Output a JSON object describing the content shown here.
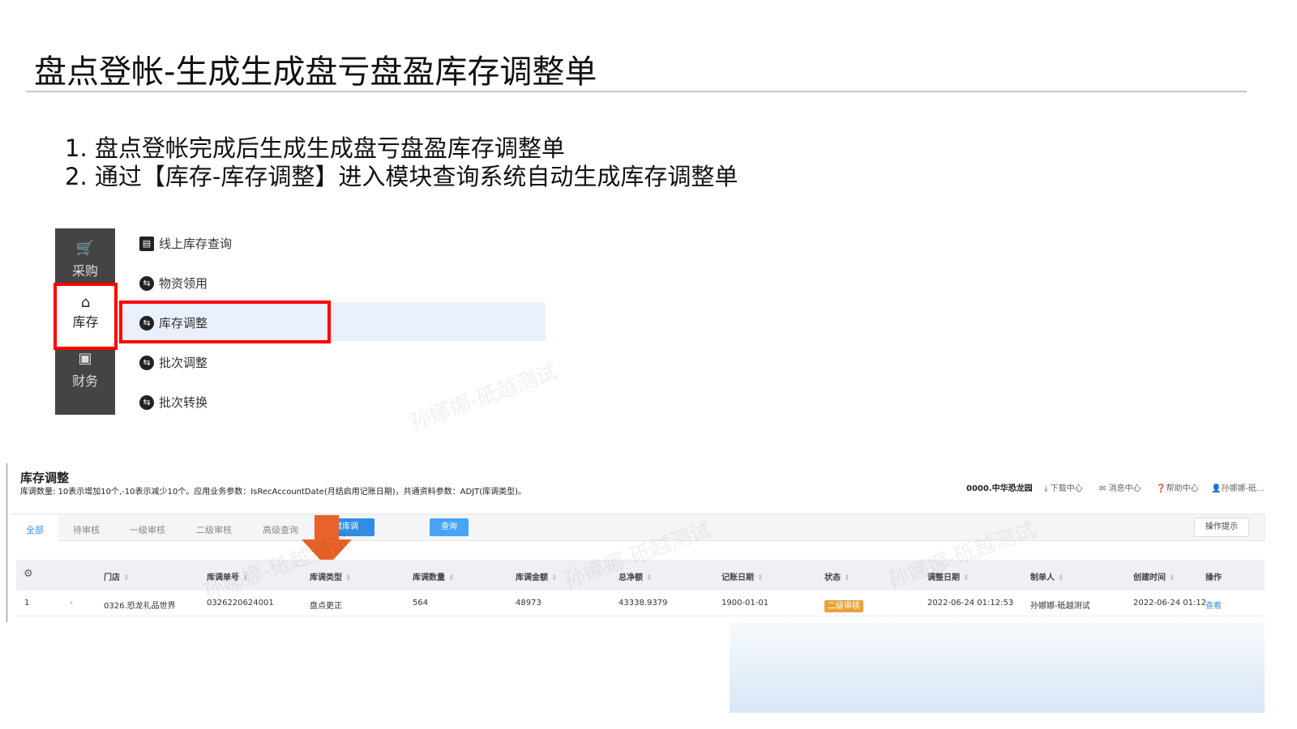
{
  "slide": {
    "title": "盘点登帐-生成生成盘亏盘盈库存调整单",
    "bullets": [
      "1.  盘点登帐完成后生成生成盘亏盘盈库存调整单",
      "2.  通过【库存-库存调整】进入模块查询系统自动生成库存调整单"
    ]
  },
  "sidebar": {
    "items": [
      {
        "label": "采购",
        "icon": "cart-icon"
      },
      {
        "label": "库存",
        "icon": "box-icon"
      },
      {
        "label": "财务",
        "icon": "finance-icon"
      }
    ]
  },
  "submenu": {
    "items": [
      "线上库存查询",
      "物资领用",
      "库存调整",
      "批次调整",
      "批次转换"
    ]
  },
  "app": {
    "title": "库存调整",
    "desc": "库调数量: 10表示增加10个,-10表示减少10个。应用业务参数：IsRecAccountDate(月结启用记账日期)，共通资料参数：ADJT(库调类型)。",
    "header": {
      "store": "0000.中华恐龙园",
      "download": "下载中心",
      "messages": "消息中心",
      "help": "帮助中心",
      "user": "孙娜娜-砥..."
    },
    "tabs": [
      "全部",
      "待审核",
      "一级审核",
      "二级审核",
      "高级查询"
    ],
    "new_button": "增库调",
    "query_button": "查询",
    "tips_button": "操作提示",
    "columns": [
      "门店",
      "库调单号",
      "库调类型",
      "库调数量",
      "库调金额",
      "总净额",
      "记账日期",
      "状态",
      "调整日期",
      "制单人",
      "创建时间",
      "操作"
    ],
    "rows": [
      {
        "index": "1",
        "cells": [
          "0326.恐龙礼品世界",
          "0326220624001",
          "盘点更正",
          "564",
          "48973",
          "43338.9379",
          "1900-01-01",
          "二级审核",
          "2022-06-24 01:12:53",
          "孙娜娜-砥越测试",
          "2022-06-24 01:12",
          "查看"
        ]
      }
    ],
    "watermark": "孙娜娜-砥越测试"
  },
  "colors": {
    "accent": "#3a8ee6",
    "highlight": "#ff0000",
    "arrow": "#e8622a",
    "badge": "#e9a23b"
  }
}
